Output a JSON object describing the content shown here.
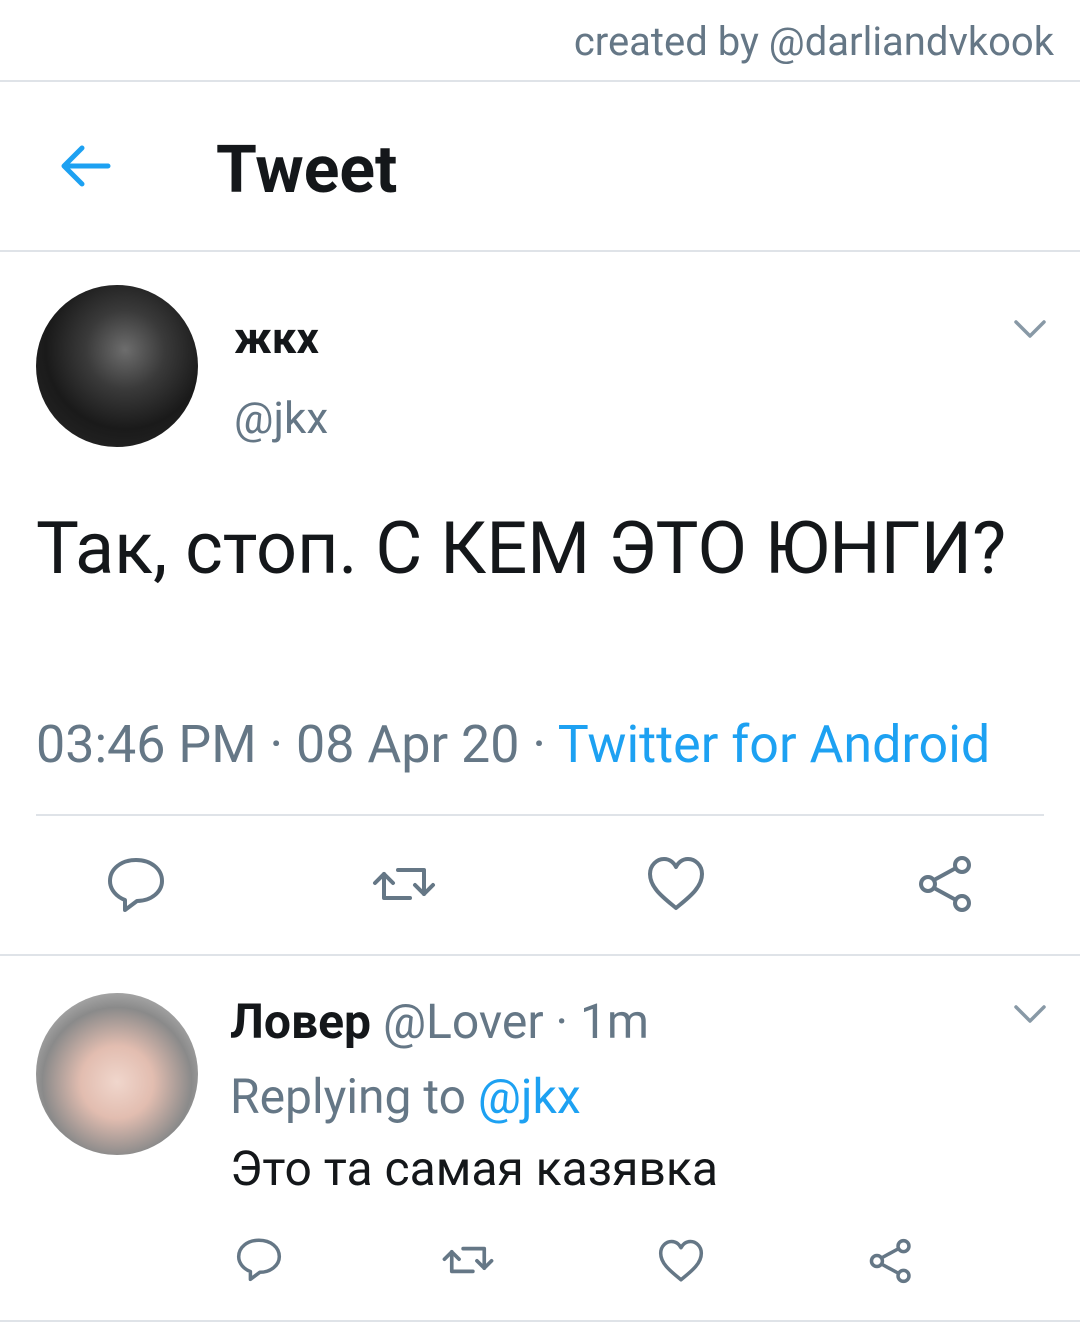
{
  "credit": "created by @darliandvkook",
  "header": {
    "title": "Tweet"
  },
  "tweet": {
    "name": "жкх",
    "handle": "@jkx",
    "text": "Так, стоп. С КЕМ ЭТО ЮНГИ?",
    "time": "03:46 PM",
    "date": "08 Apr 20",
    "separator": " · ",
    "source": "Twitter for Android"
  },
  "reply": {
    "name": "Ловер",
    "handle": "@Lover",
    "separator": " · ",
    "time": "1m",
    "replying_prefix": "Replying to ",
    "replying_to": "@jkx",
    "text": "Это та самая казявка"
  },
  "colors": {
    "accent": "#1da1f2",
    "secondary_text": "#657786",
    "divider": "#dfe3e8"
  },
  "icons": [
    "back-arrow-icon",
    "chevron-down-icon",
    "reply-icon",
    "retweet-icon",
    "like-icon",
    "share-icon"
  ]
}
